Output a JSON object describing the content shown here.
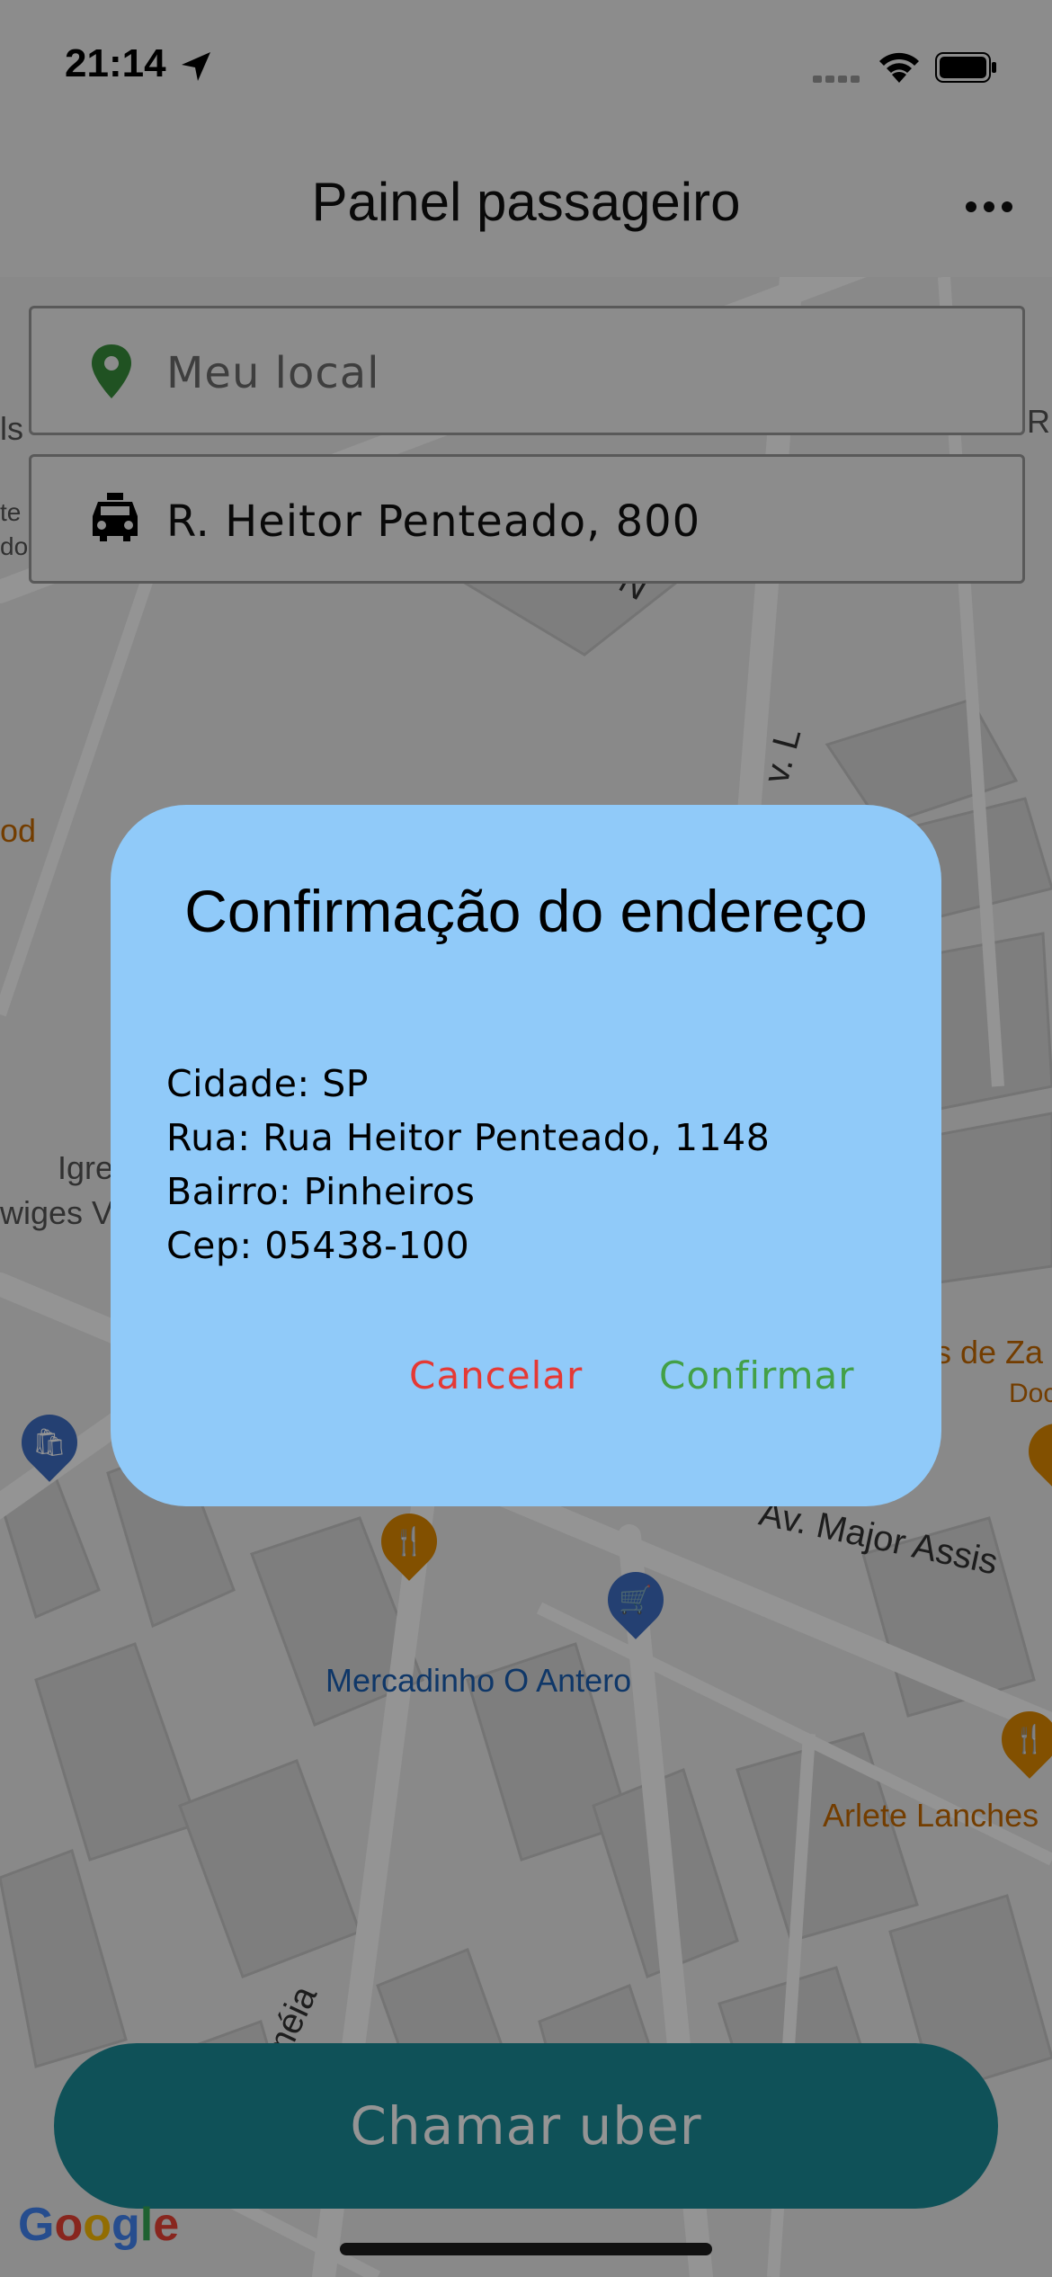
{
  "status_bar": {
    "time": "21:14",
    "icons": [
      "location-arrow-icon",
      "signal-icon",
      "wifi-icon",
      "battery-icon"
    ]
  },
  "app_bar": {
    "title": "Painel passageiro",
    "menu_icon": "more-horizontal-icon"
  },
  "origin": {
    "icon": "location-pin-icon",
    "icon_color": "#388e3c",
    "placeholder": "Meu local"
  },
  "destination": {
    "icon": "taxi-icon",
    "value": "R. Heitor Penteado, 800"
  },
  "map": {
    "labels": {
      "mercadinho": "Mercadinho O Antero",
      "arlete": "Arlete Lanches",
      "av_major": "Av. Major Assis",
      "igre": "Igre",
      "wiges": "wiges V",
      "ood": "od",
      "ls": "ls",
      "te": "te",
      "do": "do",
      "s_de_za": "s de Za",
      "doc": "Doc",
      "r_edge": "R",
      "av_l": "v. L",
      "meia": "méia",
      "n": "N"
    }
  },
  "dialog": {
    "title": "Confirmação do endereço",
    "lines": {
      "cidade": "Cidade: SP",
      "rua": "Rua: Rua Heitor Penteado, 1148",
      "bairro": "Bairro: Pinheiros",
      "cep": "Cep: 05438-100"
    },
    "cancel_label": "Cancelar",
    "confirm_label": "Confirmar",
    "background": "#90caf9",
    "cancel_color": "#e53935",
    "confirm_color": "#43a047"
  },
  "call_button": {
    "label": "Chamar uber",
    "color": "#1a8c98"
  },
  "google_logo": "Google"
}
